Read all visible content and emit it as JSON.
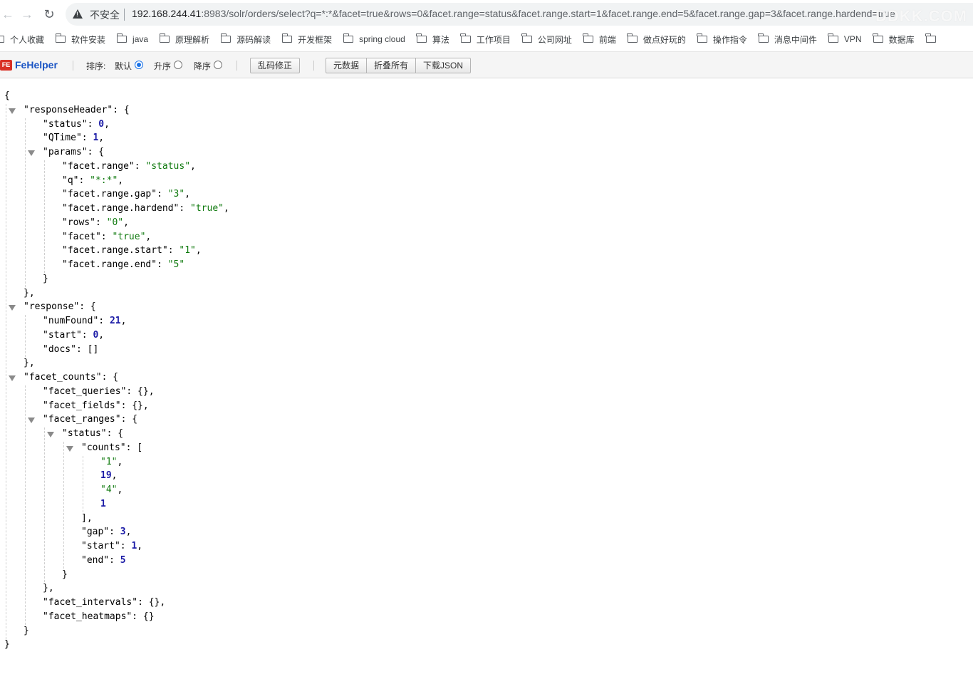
{
  "browser": {
    "security_label": "不安全",
    "url_host": "192.168.244.41",
    "url_rest": ":8983/solr/orders/select?q=*:*&facet=true&rows=0&facet.range=status&facet.range.start=1&facet.range.end=5&facet.range.gap=3&facet.range.hardend=true",
    "watermark": "DDKK.COM"
  },
  "bookmarks": [
    "个人收藏",
    "软件安装",
    "java",
    "原理解析",
    "源码解读",
    "开发框架",
    "spring cloud",
    "算法",
    "工作项目",
    "公司网址",
    "前端",
    "做点好玩的",
    "操作指令",
    "消息中间件",
    "VPN",
    "数据库"
  ],
  "fehelper": {
    "brand": "FeHelper",
    "logo_text": "FE",
    "sort_label": "排序:",
    "sort_options": [
      "默认",
      "升序",
      "降序"
    ],
    "sort_selected": "默认",
    "fix_button": "乱码修正",
    "buttons": [
      "元数据",
      "折叠所有",
      "下载JSON"
    ]
  },
  "json_lines": [
    {
      "depth": 0,
      "parts": [
        [
          "p",
          "{"
        ]
      ]
    },
    {
      "depth": 1,
      "toggle": true,
      "parts": [
        [
          "k",
          "\"responseHeader\""
        ],
        [
          "p",
          ": {"
        ]
      ]
    },
    {
      "depth": 2,
      "parts": [
        [
          "k",
          "\"status\""
        ],
        [
          "p",
          ": "
        ],
        [
          "n",
          "0"
        ],
        [
          "p",
          ","
        ]
      ]
    },
    {
      "depth": 2,
      "parts": [
        [
          "k",
          "\"QTime\""
        ],
        [
          "p",
          ": "
        ],
        [
          "n",
          "1"
        ],
        [
          "p",
          ","
        ]
      ]
    },
    {
      "depth": 2,
      "toggle": true,
      "parts": [
        [
          "k",
          "\"params\""
        ],
        [
          "p",
          ": {"
        ]
      ]
    },
    {
      "depth": 3,
      "parts": [
        [
          "k",
          "\"facet.range\""
        ],
        [
          "p",
          ": "
        ],
        [
          "s",
          "\"status\""
        ],
        [
          "p",
          ","
        ]
      ]
    },
    {
      "depth": 3,
      "parts": [
        [
          "k",
          "\"q\""
        ],
        [
          "p",
          ": "
        ],
        [
          "s",
          "\"*:*\""
        ],
        [
          "p",
          ","
        ]
      ]
    },
    {
      "depth": 3,
      "parts": [
        [
          "k",
          "\"facet.range.gap\""
        ],
        [
          "p",
          ": "
        ],
        [
          "s",
          "\"3\""
        ],
        [
          "p",
          ","
        ]
      ]
    },
    {
      "depth": 3,
      "parts": [
        [
          "k",
          "\"facet.range.hardend\""
        ],
        [
          "p",
          ": "
        ],
        [
          "s",
          "\"true\""
        ],
        [
          "p",
          ","
        ]
      ]
    },
    {
      "depth": 3,
      "parts": [
        [
          "k",
          "\"rows\""
        ],
        [
          "p",
          ": "
        ],
        [
          "s",
          "\"0\""
        ],
        [
          "p",
          ","
        ]
      ]
    },
    {
      "depth": 3,
      "parts": [
        [
          "k",
          "\"facet\""
        ],
        [
          "p",
          ": "
        ],
        [
          "s",
          "\"true\""
        ],
        [
          "p",
          ","
        ]
      ]
    },
    {
      "depth": 3,
      "parts": [
        [
          "k",
          "\"facet.range.start\""
        ],
        [
          "p",
          ": "
        ],
        [
          "s",
          "\"1\""
        ],
        [
          "p",
          ","
        ]
      ]
    },
    {
      "depth": 3,
      "parts": [
        [
          "k",
          "\"facet.range.end\""
        ],
        [
          "p",
          ": "
        ],
        [
          "s",
          "\"5\""
        ]
      ]
    },
    {
      "depth": 2,
      "parts": [
        [
          "p",
          "}"
        ]
      ]
    },
    {
      "depth": 1,
      "parts": [
        [
          "p",
          "},"
        ]
      ]
    },
    {
      "depth": 1,
      "toggle": true,
      "parts": [
        [
          "k",
          "\"response\""
        ],
        [
          "p",
          ": {"
        ]
      ]
    },
    {
      "depth": 2,
      "parts": [
        [
          "k",
          "\"numFound\""
        ],
        [
          "p",
          ": "
        ],
        [
          "n",
          "21"
        ],
        [
          "p",
          ","
        ]
      ]
    },
    {
      "depth": 2,
      "parts": [
        [
          "k",
          "\"start\""
        ],
        [
          "p",
          ": "
        ],
        [
          "n",
          "0"
        ],
        [
          "p",
          ","
        ]
      ]
    },
    {
      "depth": 2,
      "parts": [
        [
          "k",
          "\"docs\""
        ],
        [
          "p",
          ": []"
        ]
      ]
    },
    {
      "depth": 1,
      "parts": [
        [
          "p",
          "},"
        ]
      ]
    },
    {
      "depth": 1,
      "toggle": true,
      "parts": [
        [
          "k",
          "\"facet_counts\""
        ],
        [
          "p",
          ": {"
        ]
      ]
    },
    {
      "depth": 2,
      "parts": [
        [
          "k",
          "\"facet_queries\""
        ],
        [
          "p",
          ": {},"
        ]
      ]
    },
    {
      "depth": 2,
      "parts": [
        [
          "k",
          "\"facet_fields\""
        ],
        [
          "p",
          ": {},"
        ]
      ]
    },
    {
      "depth": 2,
      "toggle": true,
      "parts": [
        [
          "k",
          "\"facet_ranges\""
        ],
        [
          "p",
          ": {"
        ]
      ]
    },
    {
      "depth": 3,
      "toggle": true,
      "parts": [
        [
          "k",
          "\"status\""
        ],
        [
          "p",
          ": {"
        ]
      ]
    },
    {
      "depth": 4,
      "toggle": true,
      "parts": [
        [
          "k",
          "\"counts\""
        ],
        [
          "p",
          ": ["
        ]
      ]
    },
    {
      "depth": 5,
      "parts": [
        [
          "s",
          "\"1\""
        ],
        [
          "p",
          ","
        ]
      ]
    },
    {
      "depth": 5,
      "parts": [
        [
          "n",
          "19"
        ],
        [
          "p",
          ","
        ]
      ]
    },
    {
      "depth": 5,
      "parts": [
        [
          "s",
          "\"4\""
        ],
        [
          "p",
          ","
        ]
      ]
    },
    {
      "depth": 5,
      "parts": [
        [
          "n",
          "1"
        ]
      ]
    },
    {
      "depth": 4,
      "parts": [
        [
          "p",
          "],"
        ]
      ]
    },
    {
      "depth": 4,
      "parts": [
        [
          "k",
          "\"gap\""
        ],
        [
          "p",
          ": "
        ],
        [
          "n",
          "3"
        ],
        [
          "p",
          ","
        ]
      ]
    },
    {
      "depth": 4,
      "parts": [
        [
          "k",
          "\"start\""
        ],
        [
          "p",
          ": "
        ],
        [
          "n",
          "1"
        ],
        [
          "p",
          ","
        ]
      ]
    },
    {
      "depth": 4,
      "parts": [
        [
          "k",
          "\"end\""
        ],
        [
          "p",
          ": "
        ],
        [
          "n",
          "5"
        ]
      ]
    },
    {
      "depth": 3,
      "parts": [
        [
          "p",
          "}"
        ]
      ]
    },
    {
      "depth": 2,
      "parts": [
        [
          "p",
          "},"
        ]
      ]
    },
    {
      "depth": 2,
      "parts": [
        [
          "k",
          "\"facet_intervals\""
        ],
        [
          "p",
          ": {},"
        ]
      ]
    },
    {
      "depth": 2,
      "parts": [
        [
          "k",
          "\"facet_heatmaps\""
        ],
        [
          "p",
          ": {}"
        ]
      ]
    },
    {
      "depth": 1,
      "parts": [
        [
          "p",
          "}"
        ]
      ]
    },
    {
      "depth": 0,
      "parts": [
        [
          "p",
          "}"
        ]
      ]
    }
  ]
}
